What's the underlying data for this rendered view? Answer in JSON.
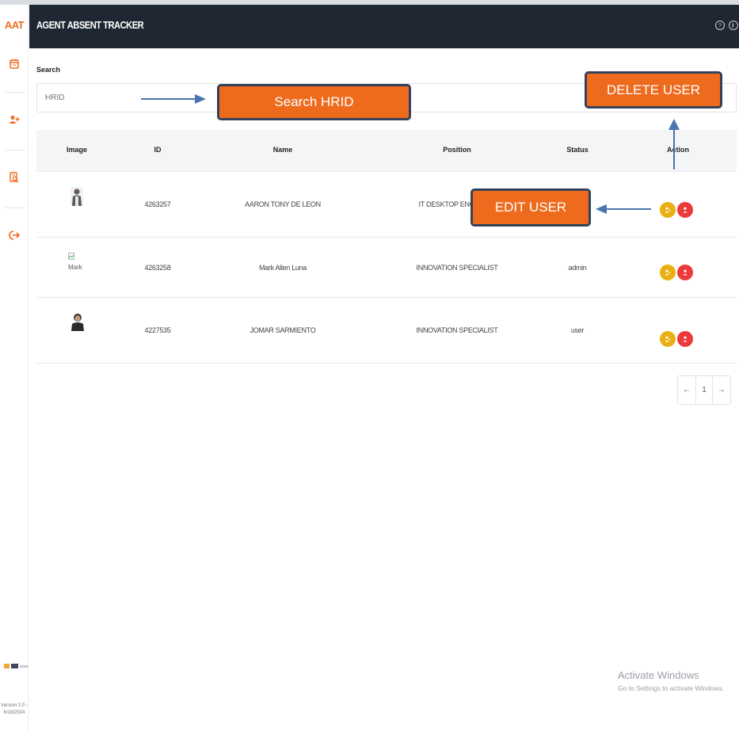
{
  "app": {
    "brand": "AAT",
    "title": "AGENT ABSENT TRACKER",
    "version": "Version 2.0 - 6/18/2024"
  },
  "sidebar": {
    "items": [
      {
        "icon": "calendar-icon"
      },
      {
        "icon": "add-user-icon"
      },
      {
        "icon": "report-search-icon"
      },
      {
        "icon": "logout-icon"
      }
    ]
  },
  "header": {
    "icons": [
      "help-icon",
      "info-icon"
    ]
  },
  "search": {
    "label": "Search",
    "placeholder": "HRID"
  },
  "table": {
    "columns": [
      "Image",
      "ID",
      "Name",
      "Position",
      "Status",
      "Action"
    ],
    "rows": [
      {
        "image": "photo",
        "id": "4263257",
        "name": "AARON TONY DE LEON",
        "position": "IT DESKTOP ENGINEER",
        "status": ""
      },
      {
        "image": "Mark",
        "id": "4263258",
        "name": "Mark Allen Luna",
        "position": "INNOVATION SPECIALIST",
        "status": "admin"
      },
      {
        "image": "photo",
        "id": "4227535",
        "name": "JOMAR SARMIENTO",
        "position": "INNOVATION SPECIALIST",
        "status": "user"
      }
    ]
  },
  "pagination": {
    "prev": "←",
    "page": "1",
    "next": "→"
  },
  "annotations": {
    "search": "Search HRID",
    "delete": "DELETE USER",
    "edit": "EDIT USER"
  },
  "watermark": {
    "line1": "Activate Windows",
    "line2": "Go to Settings to activate Windows."
  },
  "colors": {
    "accent": "#ee6b1e",
    "header_bg": "#1f2733",
    "edit_button": "#e8b012",
    "delete_button": "#ec3a3a",
    "callout_border": "#33425a"
  }
}
